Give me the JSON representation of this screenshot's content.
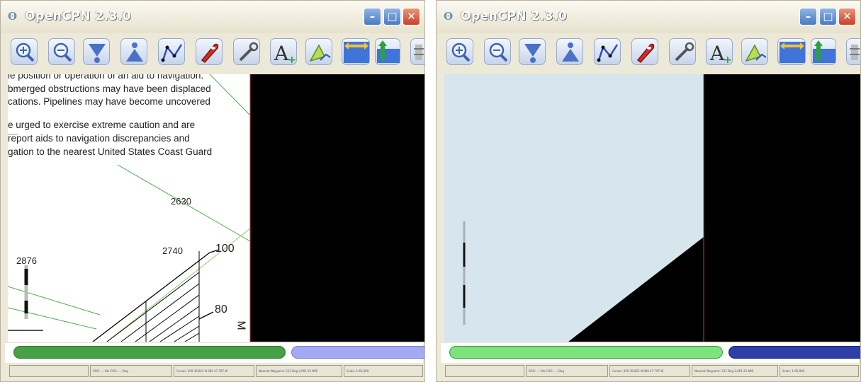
{
  "windows": [
    {
      "title": "OpenCPN 2.3.0",
      "notice_lines": [
        "le position or operation of an aid to navigation.",
        "bmerged obstructions may have been displaced",
        "cations.  Pipelines may have become uncovered",
        "e urged to exercise extreme  caution and are",
        "report aids to navigation  discrepancies and",
        "gation to the nearest United States Coast Guard"
      ],
      "soundings": [
        "2630",
        "2740",
        "100",
        "2876",
        "80"
      ],
      "edge_letter": "M",
      "status_fields": [
        "",
        "SOG: --- Kts  COG: --- Deg",
        "Cursor: 029 39.823 N 089 47.797 W",
        "Nearest Waypoint: 312 Deg 2,901.21 NMi",
        "Scale: 1:65,000",
        ""
      ],
      "colors": {
        "left_bar": "#46a046",
        "right_bar": "#a5a8f2"
      }
    },
    {
      "title": "OpenCPN 2.3.0",
      "status_fields": [
        "",
        "SOG: --- Kts  COG: --- Deg",
        "Cursor: 029 39.823 N 089 47.797 W",
        "Nearest Waypoint: 312 Deg 2,901.21 NMi",
        "Scale: 1:65,000",
        ""
      ],
      "colors": {
        "left_bar": "#7de37d",
        "right_bar": "#2d3fa8",
        "land": "#d6e6ec"
      }
    }
  ],
  "toolbar_icons": [
    "zoom-in-icon",
    "zoom-out-icon",
    "scale-in-icon",
    "scale-out-icon",
    "route-icon",
    "ship-icon",
    "settings-icon",
    "text-icon",
    "track-icon",
    "tide-icon",
    "current-icon",
    "more-icon"
  ]
}
